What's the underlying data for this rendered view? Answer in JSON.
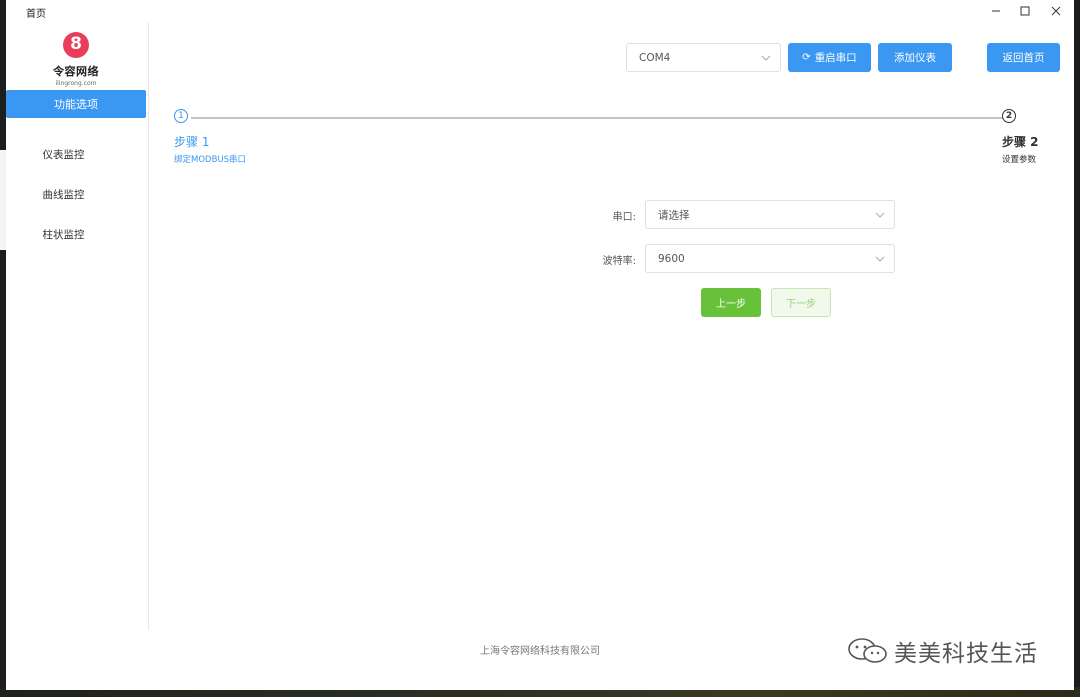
{
  "window": {
    "title": "首页",
    "controls": {
      "minimize": "—",
      "maximize": "☐",
      "close": "✕"
    }
  },
  "logo": {
    "name": "令容网络",
    "subtitle": "ilingrong.com"
  },
  "sidebar": {
    "active_item": "功能选项",
    "items": [
      {
        "label": "仪表监控"
      },
      {
        "label": "曲线监控"
      },
      {
        "label": "柱状监控"
      }
    ]
  },
  "toolbar": {
    "port_select": {
      "value": "COM4"
    },
    "restart_label": "重启串口",
    "add_meter_label": "添加仪表",
    "home_label": "返回首页"
  },
  "steps": [
    {
      "number": "1",
      "title": "步骤 1",
      "description": "绑定MODBUS串口",
      "status": "active"
    },
    {
      "number": "2",
      "title": "步骤 2",
      "description": "设置参数",
      "status": "pending"
    }
  ],
  "form": {
    "port": {
      "label": "串口:",
      "placeholder": "请选择"
    },
    "baud": {
      "label": "波特率:",
      "value": "9600"
    },
    "prev_label": "上一步",
    "next_label": "下一步"
  },
  "footer": {
    "company": "上海令容网络科技有限公司"
  },
  "watermark": {
    "text": "美美科技生活"
  },
  "colors": {
    "primary": "#3a97f2",
    "success": "#67c23a",
    "brand": "#e83e5c"
  }
}
